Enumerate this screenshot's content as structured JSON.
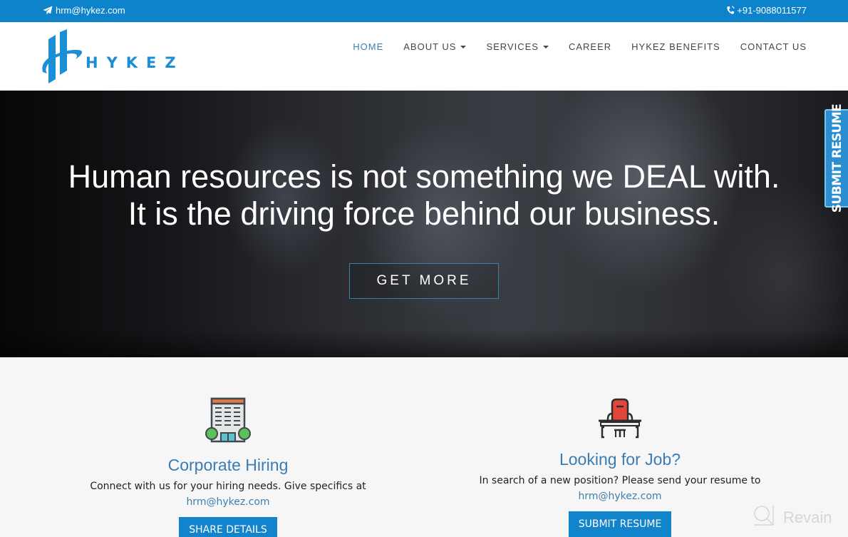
{
  "topbar": {
    "email": "hrm@hykez.com",
    "email_icon": "paper-plane-icon",
    "phone": "+91-9088011577",
    "phone_icon": "phone-icon",
    "background": "#0d83cb"
  },
  "brand": {
    "name": "HYKEZ",
    "color": "#1a8fd6"
  },
  "nav": {
    "items": [
      {
        "label": "HOME",
        "active": true
      },
      {
        "label": "ABOUT US",
        "dropdown": true
      },
      {
        "label": "SERVICES",
        "dropdown": true
      },
      {
        "label": "CAREER"
      },
      {
        "label": "HYKEZ BENEFITS"
      },
      {
        "label": "CONTACT US"
      }
    ]
  },
  "hero": {
    "headline_line1": "Human resources is not something we DEAL with.",
    "headline_line2": "It is the driving force behind our business.",
    "cta_label": "GET MORE"
  },
  "side_tab": {
    "label": "SUBMIT RESUME"
  },
  "cards": [
    {
      "icon": "office-building-icon",
      "title": "Corporate Hiring",
      "text": "Connect with us for your hiring needs. Give specifics at",
      "link": "hrm@hykez.com",
      "button": "SHARE DETAILS"
    },
    {
      "icon": "office-chair-desk-icon",
      "title": "Looking for Job?",
      "text": "In search of a new position? Please send your resume to",
      "link": "hrm@hykez.com",
      "button": "SUBMIT RESUME"
    }
  ],
  "watermark": {
    "label": "Revain"
  },
  "colors": {
    "accent": "#1284cc",
    "link": "#3f7fad",
    "title": "#3a7db5",
    "nav_active": "#3c7fb1"
  }
}
